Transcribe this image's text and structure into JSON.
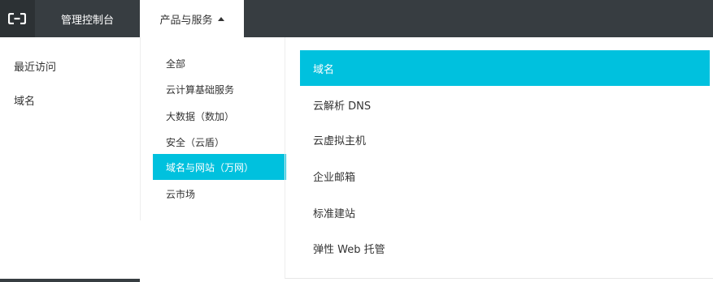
{
  "header": {
    "logo_icon": "alibaba-cloud-logo",
    "console_label": "管理控制台",
    "products_label": "产品与服务",
    "products_icon": "caret-up-icon"
  },
  "recent": {
    "title": "最近访问",
    "items": [
      "域名"
    ]
  },
  "categories": [
    {
      "label": "全部",
      "active": false
    },
    {
      "label": "云计算基础服务",
      "active": false
    },
    {
      "label": "大数据（数加）",
      "active": false
    },
    {
      "label": "安全（云盾）",
      "active": false
    },
    {
      "label": "域名与网站（万网）",
      "active": true
    },
    {
      "label": "云市场",
      "active": false
    }
  ],
  "products": [
    {
      "label": "域名",
      "active": true
    },
    {
      "label": "云解析 DNS",
      "active": false
    },
    {
      "label": "云虚拟主机",
      "active": false
    },
    {
      "label": "企业邮箱",
      "active": false
    },
    {
      "label": "标准建站",
      "active": false
    },
    {
      "label": "弹性 Web 托管",
      "active": false
    }
  ],
  "colors": {
    "topbar": "#373d41",
    "accent": "#00c1de"
  }
}
